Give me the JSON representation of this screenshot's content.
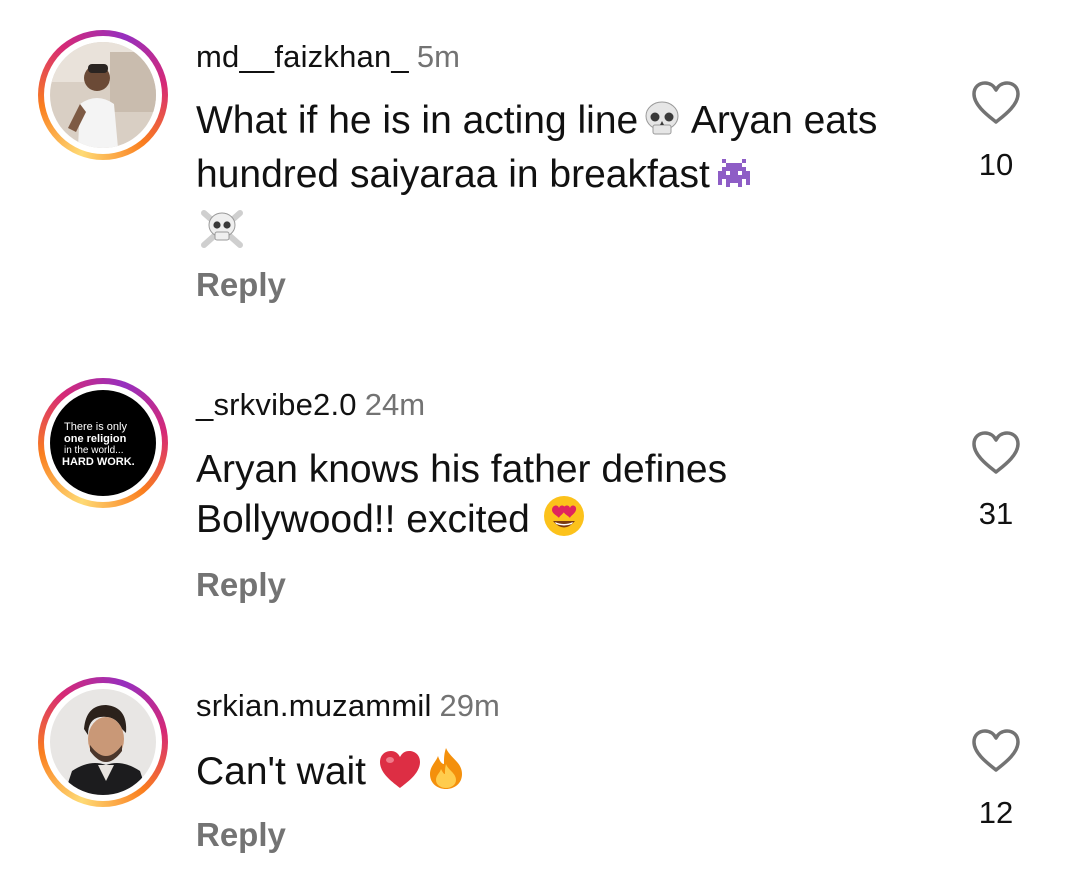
{
  "comments": [
    {
      "username": "md__faizkhan_",
      "time": "5m",
      "text_part1": "What if he is in acting line",
      "text_part2": " Aryan eats hundred saiyaraa in breakfast",
      "reply_label": "Reply",
      "likes": "10",
      "emojis": [
        "skull-emoji",
        "alien-monster-emoji",
        "skull-crossbones-emoji"
      ]
    },
    {
      "username": "_srkvibe2.0",
      "time": "24m",
      "text": "Aryan knows his father defines Bollywood!! excited",
      "reply_label": "Reply",
      "likes": "31",
      "avatar_text": [
        "There is only",
        "one religion",
        "in the world...",
        "HARD WORK."
      ],
      "emojis": [
        "heart-eyes-emoji"
      ]
    },
    {
      "username": "srkian.muzammil",
      "time": "29m",
      "text": "Can't wait",
      "reply_label": "Reply",
      "likes": "12",
      "emojis": [
        "red-heart-emoji",
        "fire-emoji"
      ]
    }
  ],
  "colors": {
    "secondary_text": "#737373",
    "primary_text": "#111111",
    "ring_gradient": [
      "#feda75",
      "#fa7e1e",
      "#d62976",
      "#962fbf"
    ]
  },
  "icons": {
    "like": "heart-outline-icon"
  }
}
